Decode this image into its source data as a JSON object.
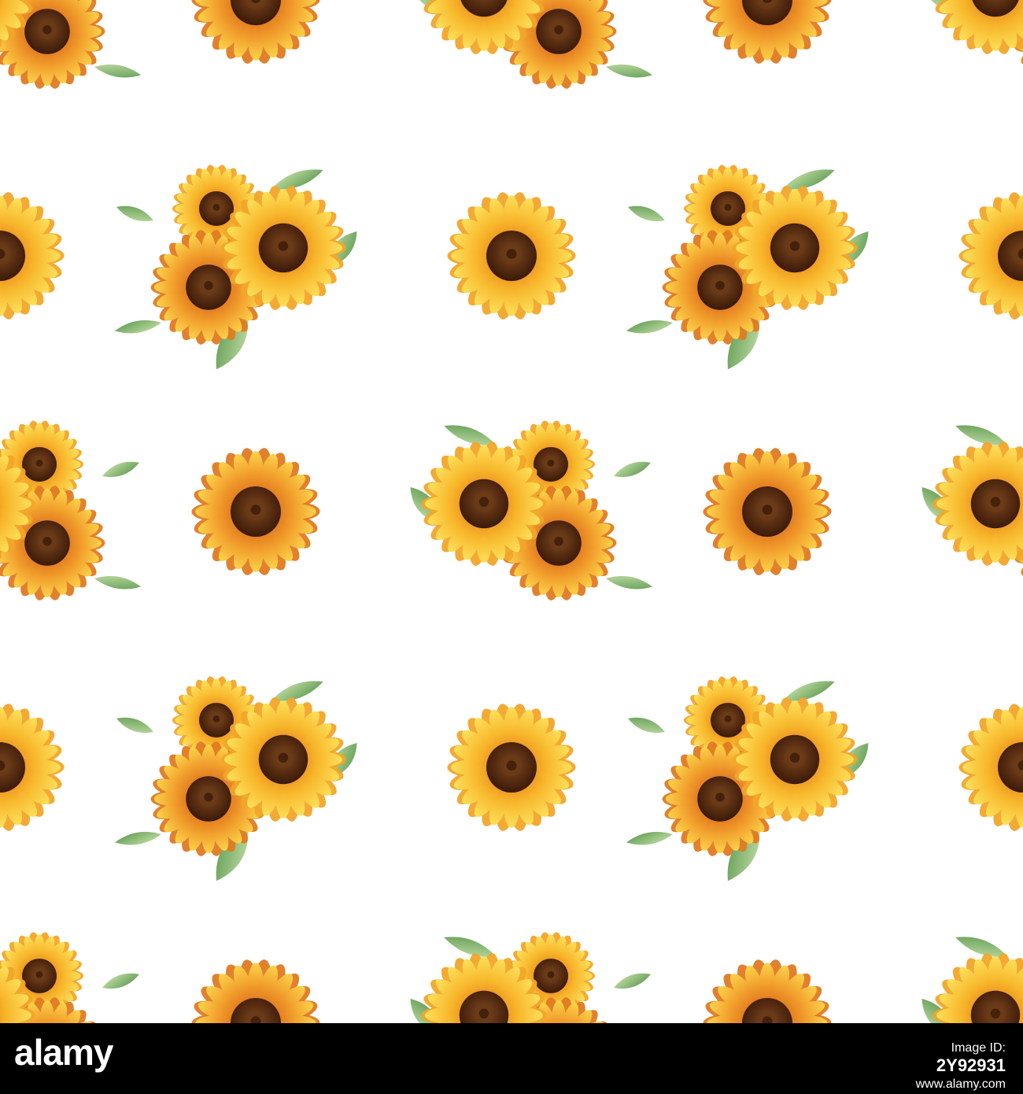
{
  "footer": {
    "brand": "alamy",
    "image_id_label": "Image ID:",
    "image_id_value": "2Y92931",
    "site": "www.alamy.com"
  },
  "colors": {
    "background": "#ffffff",
    "petal_outer": "#e8801f",
    "petal_inner": "#f7c630",
    "petal_light": "#fde05a",
    "center_dark": "#4a2410",
    "center_mid": "#6b3a17",
    "leaf": "#6fa860",
    "leaf_light": "#a9cf8a",
    "footer_bg": "#000000",
    "footer_text": "#ffffff"
  },
  "pattern": {
    "description_icons": [
      "sunflower-icon",
      "sunflower-bouquet-icon"
    ]
  }
}
